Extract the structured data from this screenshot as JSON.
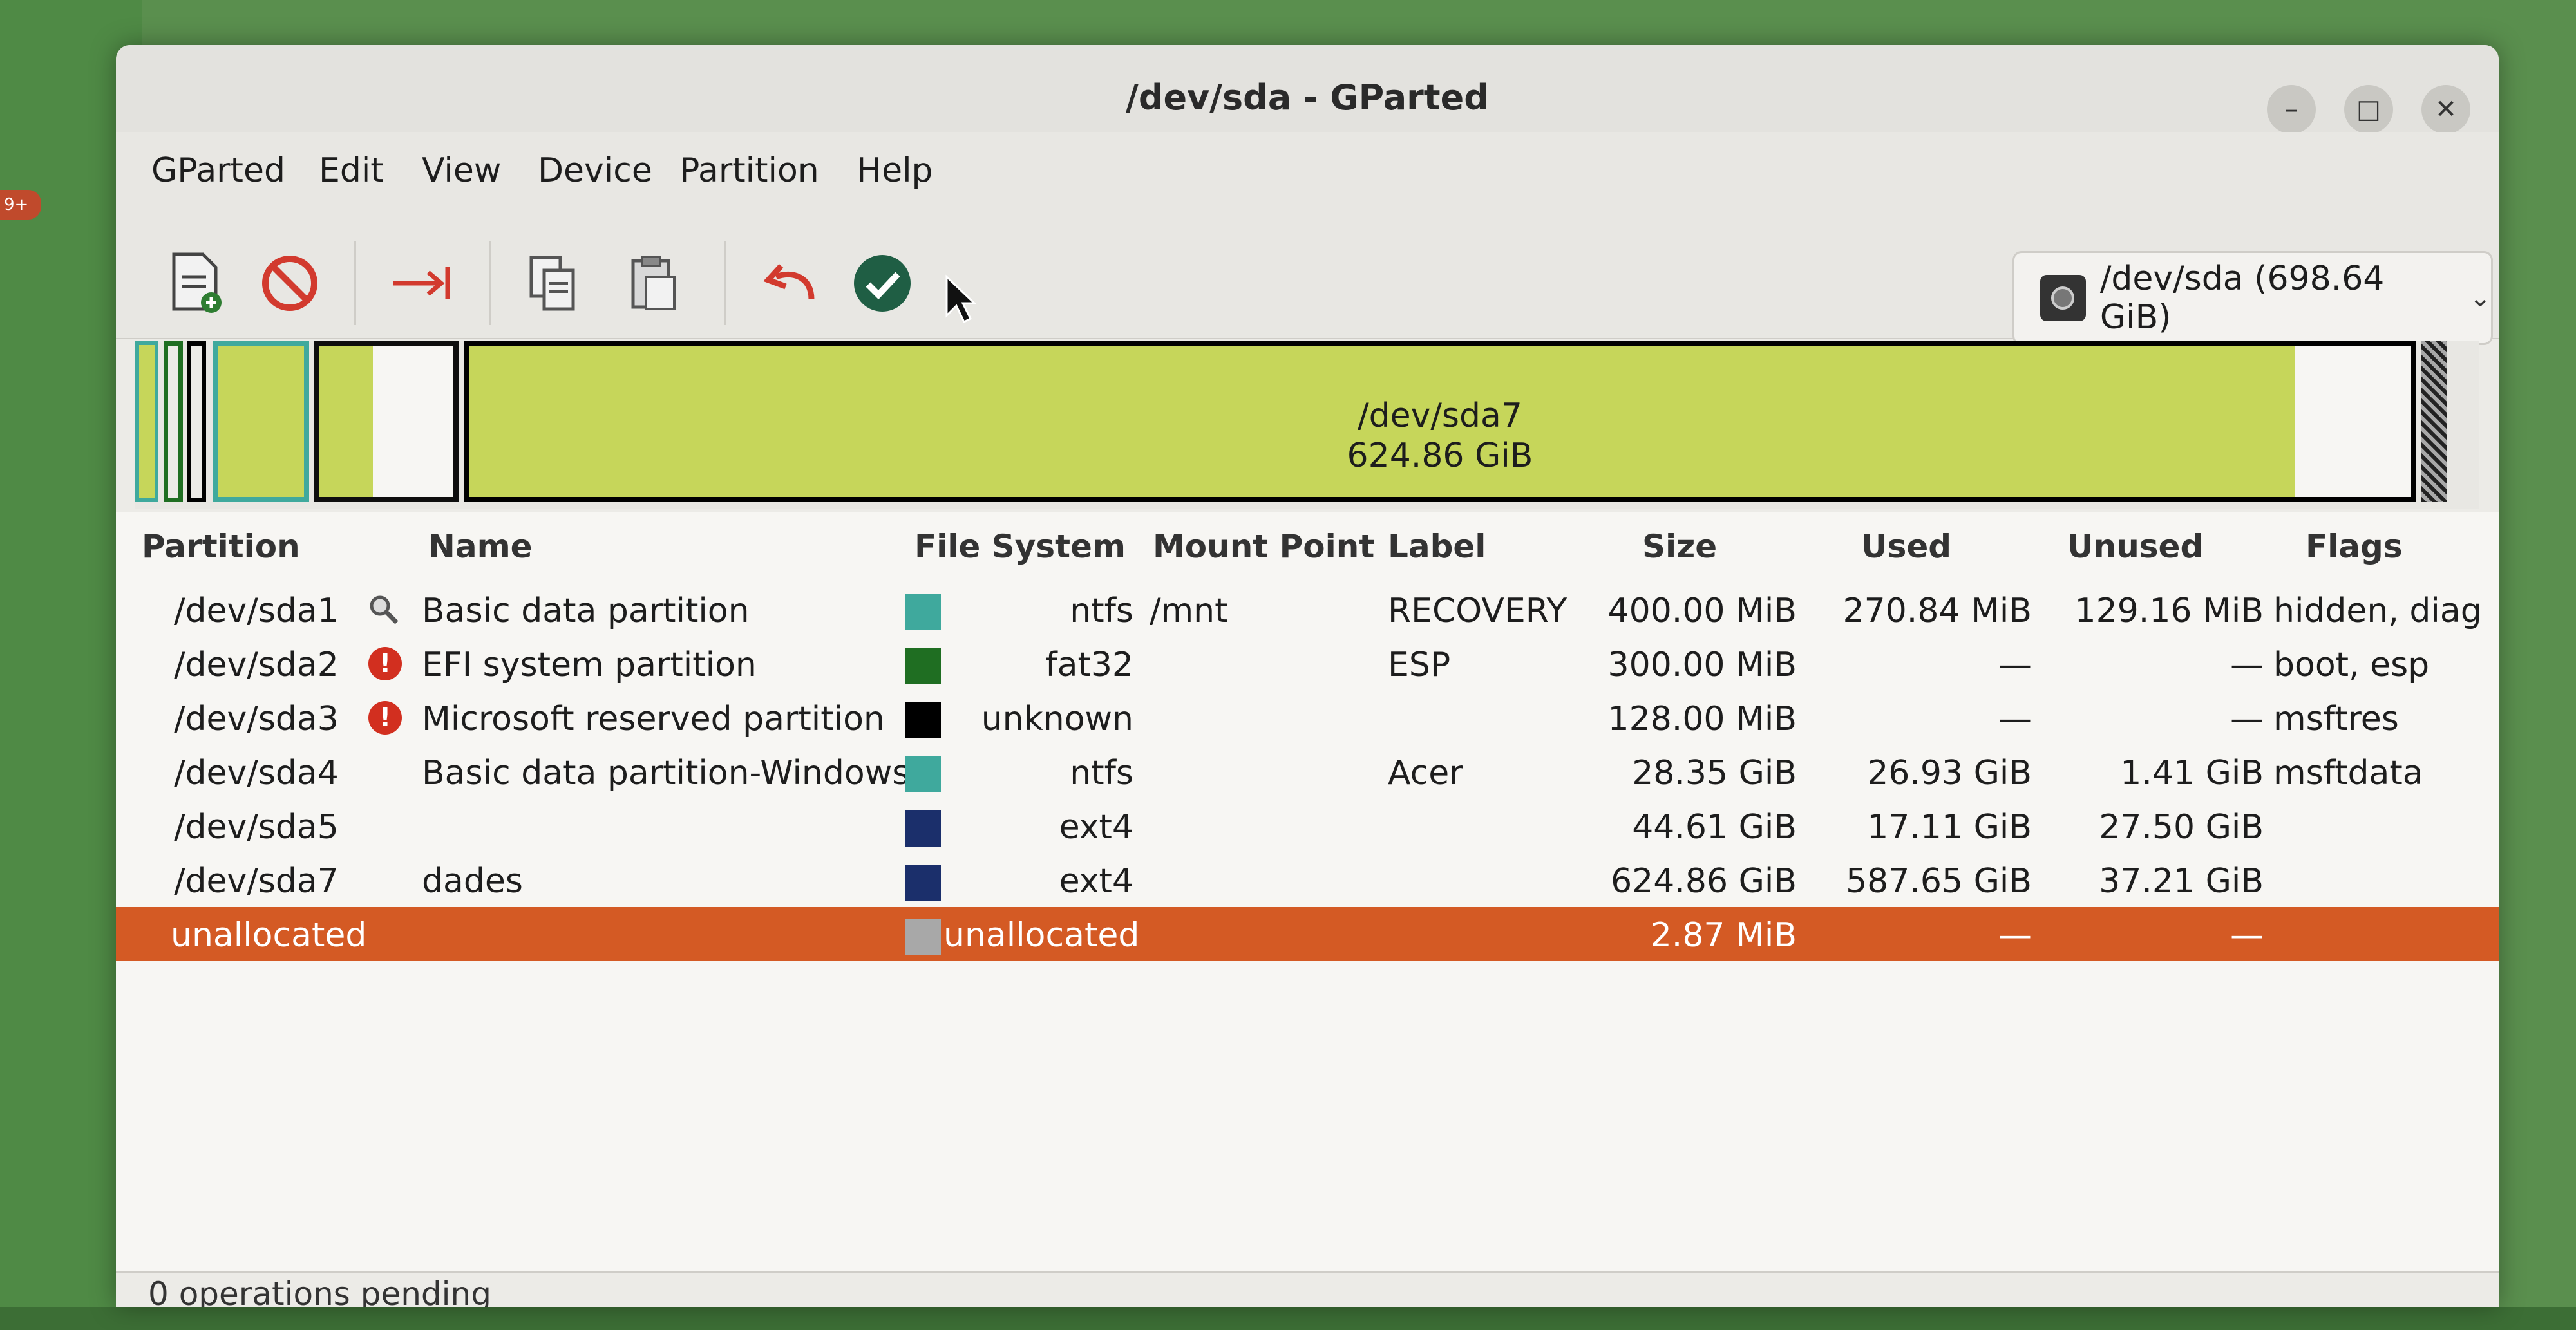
{
  "window": {
    "title": "/dev/sda - GParted"
  },
  "menu": [
    "GParted",
    "Edit",
    "View",
    "Device",
    "Partition",
    "Help"
  ],
  "device_selector": {
    "label": "/dev/sda (698.64 GiB)"
  },
  "diskmap": {
    "selected_name": "/dev/sda7",
    "selected_size": "624.86 GiB"
  },
  "columns": [
    "Partition",
    "Name",
    "File System",
    "Mount Point",
    "Label",
    "Size",
    "Used",
    "Unused",
    "Flags"
  ],
  "partitions": [
    {
      "partition": "/dev/sda1",
      "name": "Basic data partition",
      "icon": "search-icon",
      "fs": "ntfs",
      "fs_color": "#3fa99d",
      "mount": "/mnt",
      "label": "RECOVERY",
      "size": "400.00 MiB",
      "used": "270.84 MiB",
      "unused": "129.16 MiB",
      "flags": "hidden, diag"
    },
    {
      "partition": "/dev/sda2",
      "name": "EFI system partition",
      "icon": "warning-icon",
      "fs": "fat32",
      "fs_color": "#1f6e22",
      "mount": "",
      "label": "ESP",
      "size": "300.00 MiB",
      "used": "—",
      "unused": "—",
      "flags": "boot, esp"
    },
    {
      "partition": "/dev/sda3",
      "name": "Microsoft reserved partition",
      "icon": "warning-icon",
      "fs": "unknown",
      "fs_color": "#000000",
      "mount": "",
      "label": "",
      "size": "128.00 MiB",
      "used": "—",
      "unused": "—",
      "flags": "msftres"
    },
    {
      "partition": "/dev/sda4",
      "name": "Basic data partition-Windows",
      "icon": "",
      "fs": "ntfs",
      "fs_color": "#3fa99d",
      "mount": "",
      "label": "Acer",
      "size": "28.35 GiB",
      "used": "26.93 GiB",
      "unused": "1.41 GiB",
      "flags": "msftdata"
    },
    {
      "partition": "/dev/sda5",
      "name": "",
      "icon": "",
      "fs": "ext4",
      "fs_color": "#1b2f6b",
      "mount": "",
      "label": "",
      "size": "44.61 GiB",
      "used": "17.11 GiB",
      "unused": "27.50 GiB",
      "flags": ""
    },
    {
      "partition": "/dev/sda7",
      "name": "dades",
      "icon": "",
      "fs": "ext4",
      "fs_color": "#1b2f6b",
      "mount": "",
      "label": "",
      "size": "624.86 GiB",
      "used": "587.65 GiB",
      "unused": "37.21 GiB",
      "flags": ""
    },
    {
      "partition": "unallocated",
      "name": "",
      "icon": "",
      "fs": "unallocated",
      "fs_color": "#a8a8a8",
      "mount": "",
      "label": "",
      "size": "2.87 MiB",
      "used": "—",
      "unused": "—",
      "flags": "",
      "selected": true
    }
  ],
  "status": {
    "text": "0 operations pending"
  },
  "background": {
    "badge": "9+"
  },
  "colors": {
    "accent": "#d45a24",
    "ntfs": "#3fa99d",
    "used_fill": "#c6d65a",
    "border": "#000000"
  }
}
